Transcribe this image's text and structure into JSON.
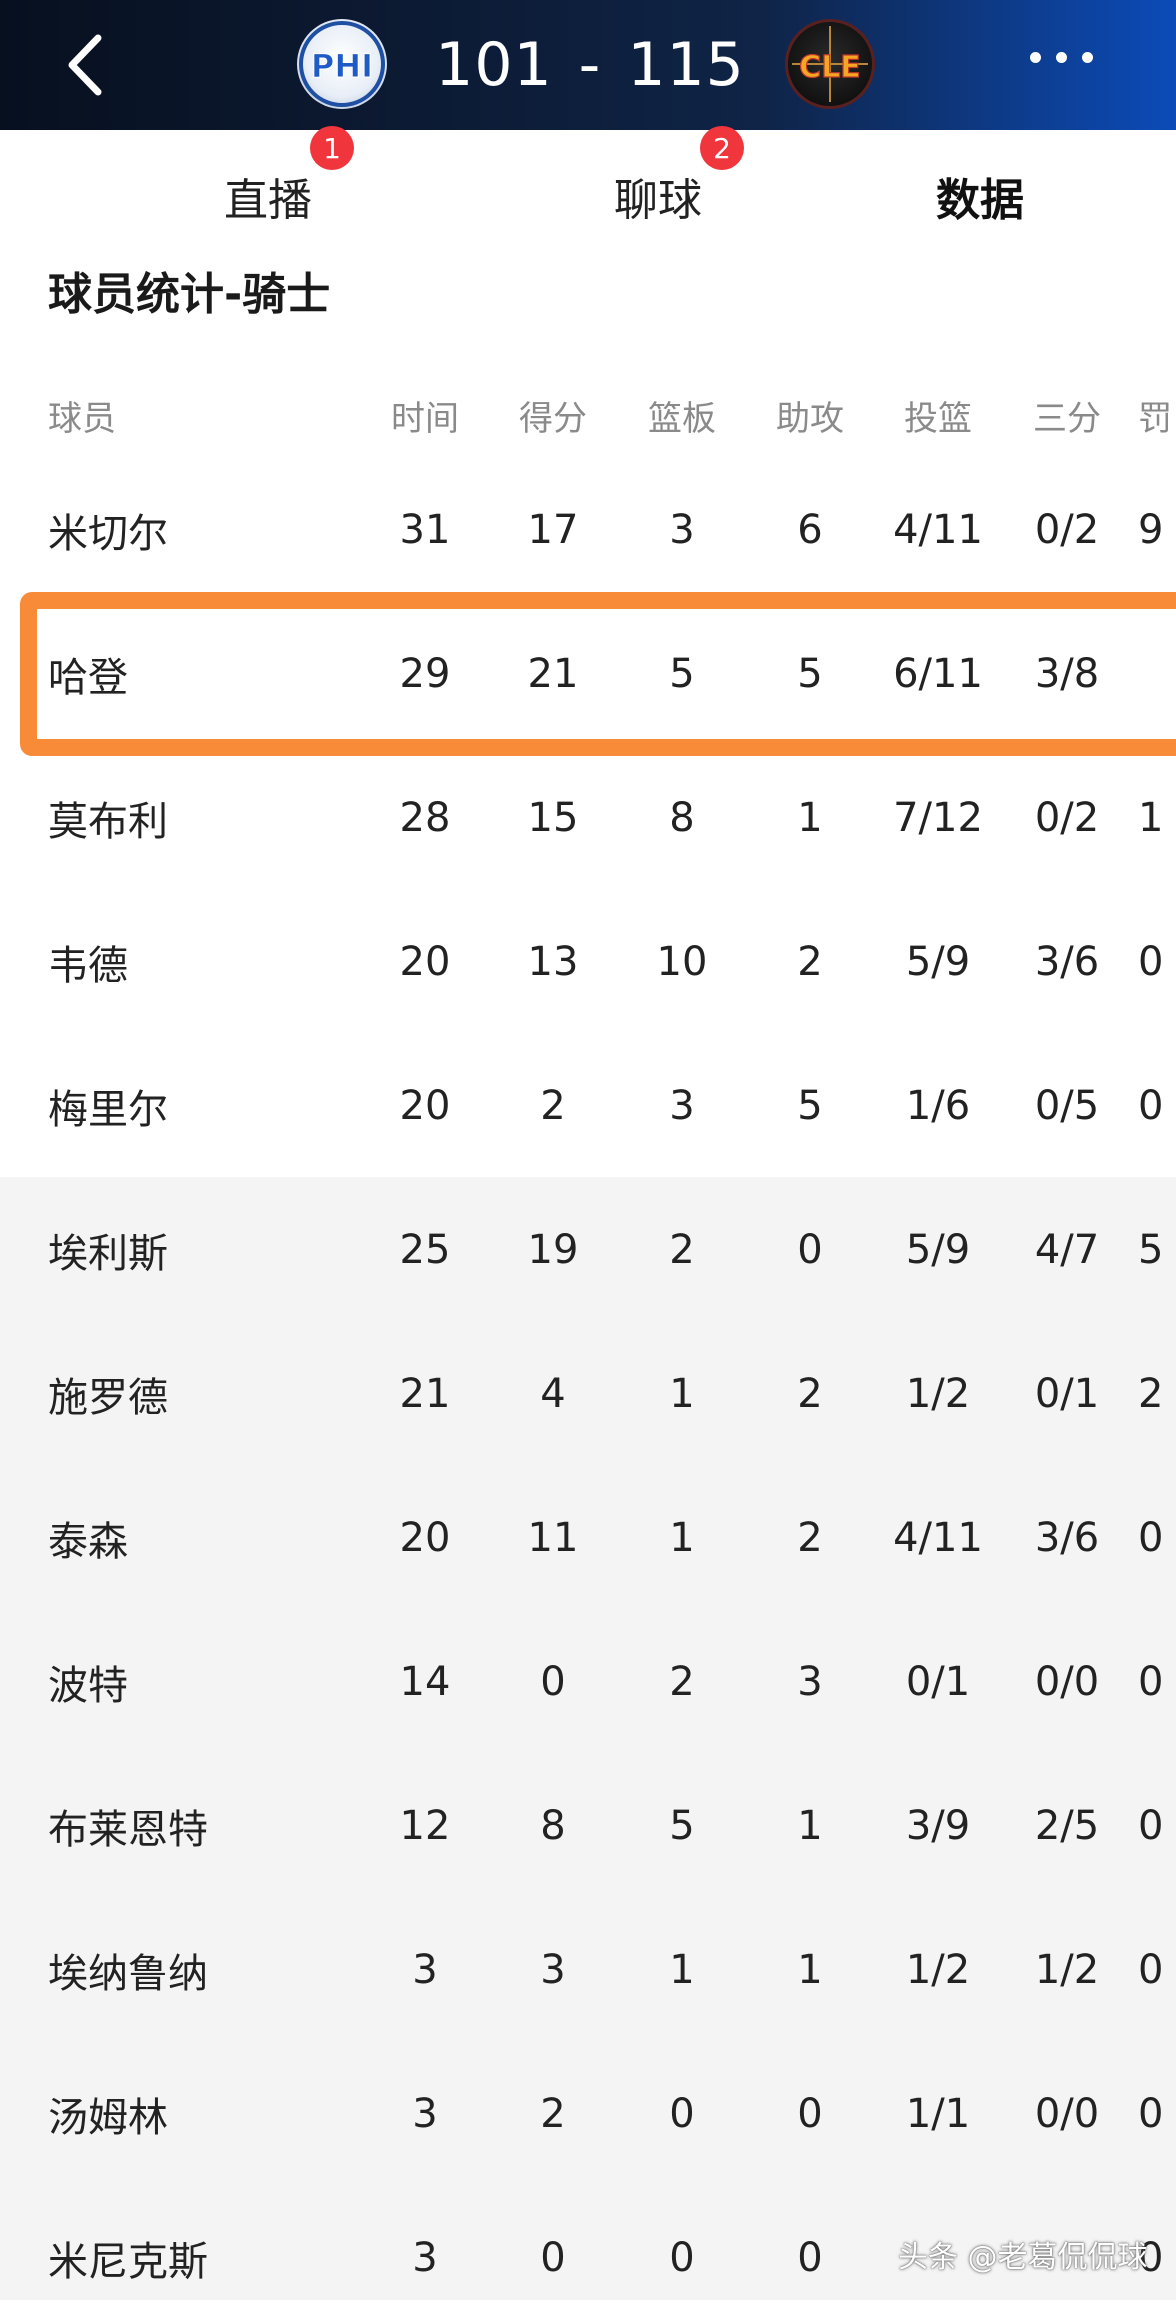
{
  "header": {
    "home_team": "PHI",
    "away_team": "CLE",
    "home_score": "101",
    "score_separator": "-",
    "away_score": "115",
    "gradient_colors": [
      "#07101f",
      "#0c4bb8"
    ]
  },
  "tabs": [
    {
      "label": "直播",
      "badge": "1"
    },
    {
      "label": "聊球",
      "badge": "2"
    },
    {
      "label": "数据",
      "badge": null,
      "active": true
    }
  ],
  "accent_color": "#e8383e",
  "highlight_color": "#f78b38",
  "section": {
    "title": "球员统计-骑士",
    "columns": [
      "球员",
      "时间",
      "得分",
      "篮板",
      "助攻",
      "投篮",
      "三分",
      "罚"
    ],
    "starters": [
      {
        "name": "米切尔",
        "min": "31",
        "pts": "17",
        "reb": "3",
        "ast": "6",
        "fg": "4/11",
        "tp": "0/2",
        "ft": "9"
      },
      {
        "name": "哈登",
        "min": "29",
        "pts": "21",
        "reb": "5",
        "ast": "5",
        "fg": "6/11",
        "tp": "3/8",
        "ft": ""
      },
      {
        "name": "莫布利",
        "min": "28",
        "pts": "15",
        "reb": "8",
        "ast": "1",
        "fg": "7/12",
        "tp": "0/2",
        "ft": "1"
      },
      {
        "name": "韦德",
        "min": "20",
        "pts": "13",
        "reb": "10",
        "ast": "2",
        "fg": "5/9",
        "tp": "3/6",
        "ft": "0"
      },
      {
        "name": "梅里尔",
        "min": "20",
        "pts": "2",
        "reb": "3",
        "ast": "5",
        "fg": "1/6",
        "tp": "0/5",
        "ft": "0"
      }
    ],
    "bench": [
      {
        "name": "埃利斯",
        "min": "25",
        "pts": "19",
        "reb": "2",
        "ast": "0",
        "fg": "5/9",
        "tp": "4/7",
        "ft": "5"
      },
      {
        "name": "施罗德",
        "min": "21",
        "pts": "4",
        "reb": "1",
        "ast": "2",
        "fg": "1/2",
        "tp": "0/1",
        "ft": "2"
      },
      {
        "name": "泰森",
        "min": "20",
        "pts": "11",
        "reb": "1",
        "ast": "2",
        "fg": "4/11",
        "tp": "3/6",
        "ft": "0"
      },
      {
        "name": "波特",
        "min": "14",
        "pts": "0",
        "reb": "2",
        "ast": "3",
        "fg": "0/1",
        "tp": "0/0",
        "ft": "0"
      },
      {
        "name": "布莱恩特",
        "min": "12",
        "pts": "8",
        "reb": "5",
        "ast": "1",
        "fg": "3/9",
        "tp": "2/5",
        "ft": "0"
      },
      {
        "name": "埃纳鲁纳",
        "min": "3",
        "pts": "3",
        "reb": "1",
        "ast": "1",
        "fg": "1/2",
        "tp": "1/2",
        "ft": "0"
      },
      {
        "name": "汤姆林",
        "min": "3",
        "pts": "2",
        "reb": "0",
        "ast": "0",
        "fg": "1/1",
        "tp": "0/0",
        "ft": "0"
      },
      {
        "name": "米尼克斯",
        "min": "3",
        "pts": "0",
        "reb": "0",
        "ast": "0",
        "fg": "",
        "tp": "",
        "ft": "0"
      }
    ]
  },
  "watermark": "头条 @老葛侃侃球"
}
